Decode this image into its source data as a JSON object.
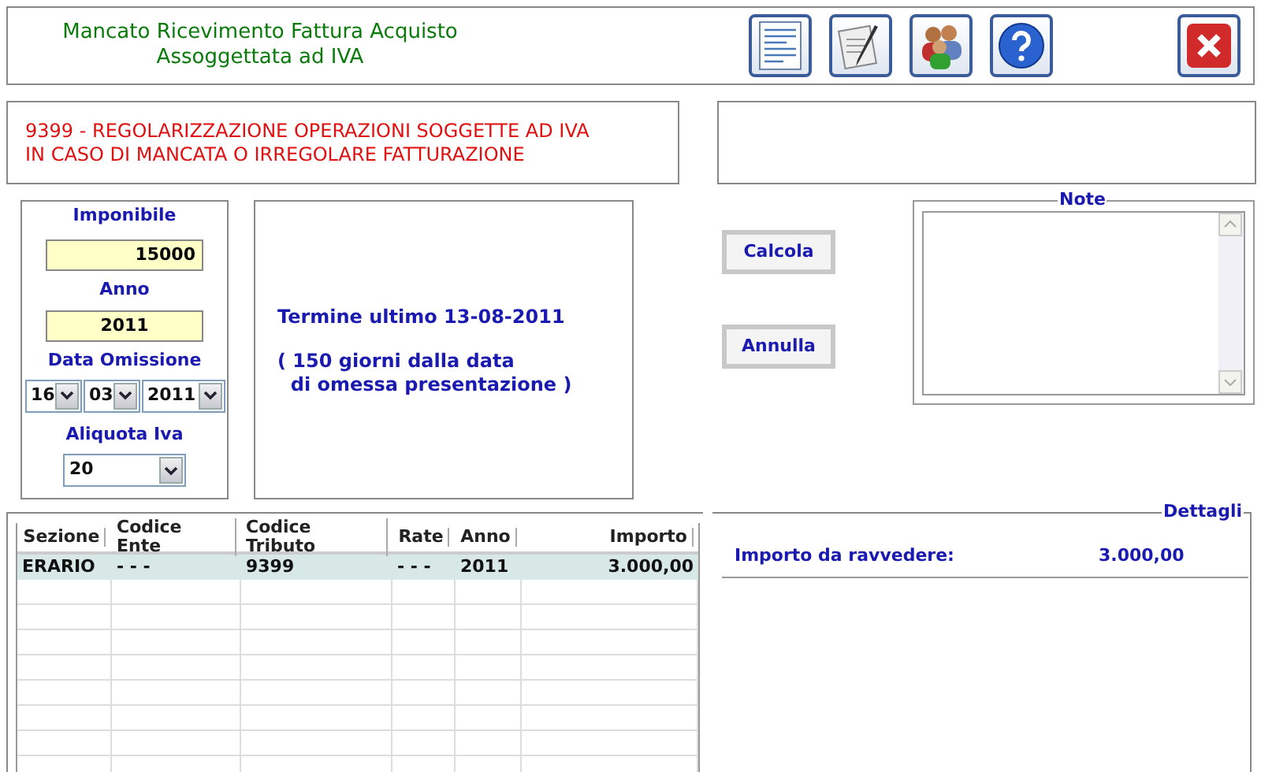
{
  "header": {
    "title_lines": [
      "Mancato Ricevimento Fattura Acquisto",
      "Assoggettata ad IVA"
    ]
  },
  "description": {
    "lines": [
      "9399 - REGOLARIZZAZIONE OPERAZIONI SOGGETTE AD IVA",
      "IN CASO DI MANCATA O IRREGOLARE FATTURAZIONE"
    ]
  },
  "form": {
    "imponibile": {
      "label": "Imponibile",
      "value": "15000"
    },
    "anno": {
      "label": "Anno",
      "value": "2011"
    },
    "data_omissione": {
      "label": "Data Omissione",
      "day": "16",
      "month": "03",
      "year": "2011"
    },
    "aliquota": {
      "label": "Aliquota Iva",
      "value": "20"
    }
  },
  "deadline": {
    "line": "Termine ultimo 13-08-2011",
    "note_lines": [
      "( 150 giorni dalla data",
      "  di omessa presentazione )"
    ]
  },
  "buttons": [
    "Calcola",
    "Annulla"
  ],
  "note": {
    "legend": "Note"
  },
  "table": {
    "columns": [
      "Sezione",
      "Codice Ente",
      "Codice Tributo",
      "Rate",
      "Anno",
      "Importo"
    ],
    "rows": [
      {
        "selected": true,
        "cells": [
          "ERARIO",
          "- - -",
          "9399",
          "- - -",
          "2011",
          "3.000,00"
        ]
      }
    ]
  },
  "details": {
    "legend": "Dettagli",
    "label": "Importo da ravvedere:",
    "value": "3.000,00"
  }
}
